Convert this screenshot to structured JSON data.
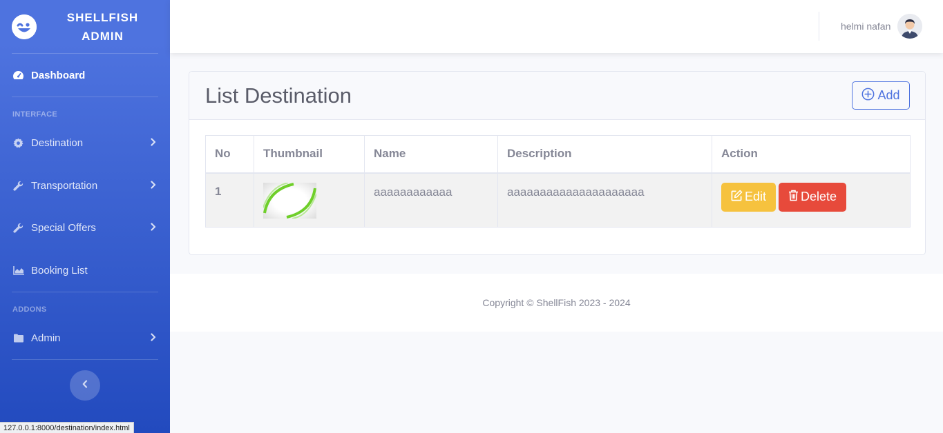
{
  "brand": {
    "line1": "SHELLFISH",
    "line2": "ADMIN",
    "logo_icon": "laugh-wink-icon"
  },
  "sidebar": {
    "dashboard": {
      "label": "Dashboard",
      "icon": "tachometer-icon"
    },
    "heading_interface": "INTERFACE",
    "items": [
      {
        "label": "Destination",
        "icon": "cog-icon"
      },
      {
        "label": "Transportation",
        "icon": "wrench-icon"
      },
      {
        "label": "Special Offers",
        "icon": "wrench-icon"
      },
      {
        "label": "Booking List",
        "icon": "chart-area-icon"
      }
    ],
    "heading_addons": "ADDONS",
    "admin": {
      "label": "Admin",
      "icon": "folder-icon"
    },
    "toggle_icon": "chevron-left-icon"
  },
  "topbar": {
    "user_name": "helmi nafan"
  },
  "card": {
    "title": "List Destination",
    "add_label": "Add",
    "columns": [
      "No",
      "Thumbnail",
      "Name",
      "Description",
      "Action"
    ],
    "rows": [
      {
        "no": "1",
        "name": "aaaaaaaaaaaa",
        "description": "aaaaaaaaaaaaaaaaaaaaa",
        "edit_label": "Edit",
        "delete_label": "Delete"
      }
    ]
  },
  "footer": {
    "copyright": "Copyright © ShellFish 2023 - 2024"
  },
  "statusbar": {
    "url": "127.0.0.1:8000/destination/index.html"
  },
  "colors": {
    "primary": "#4e73df",
    "warning": "#f6c23e",
    "danger": "#e74a3b",
    "text_muted": "#858796"
  }
}
